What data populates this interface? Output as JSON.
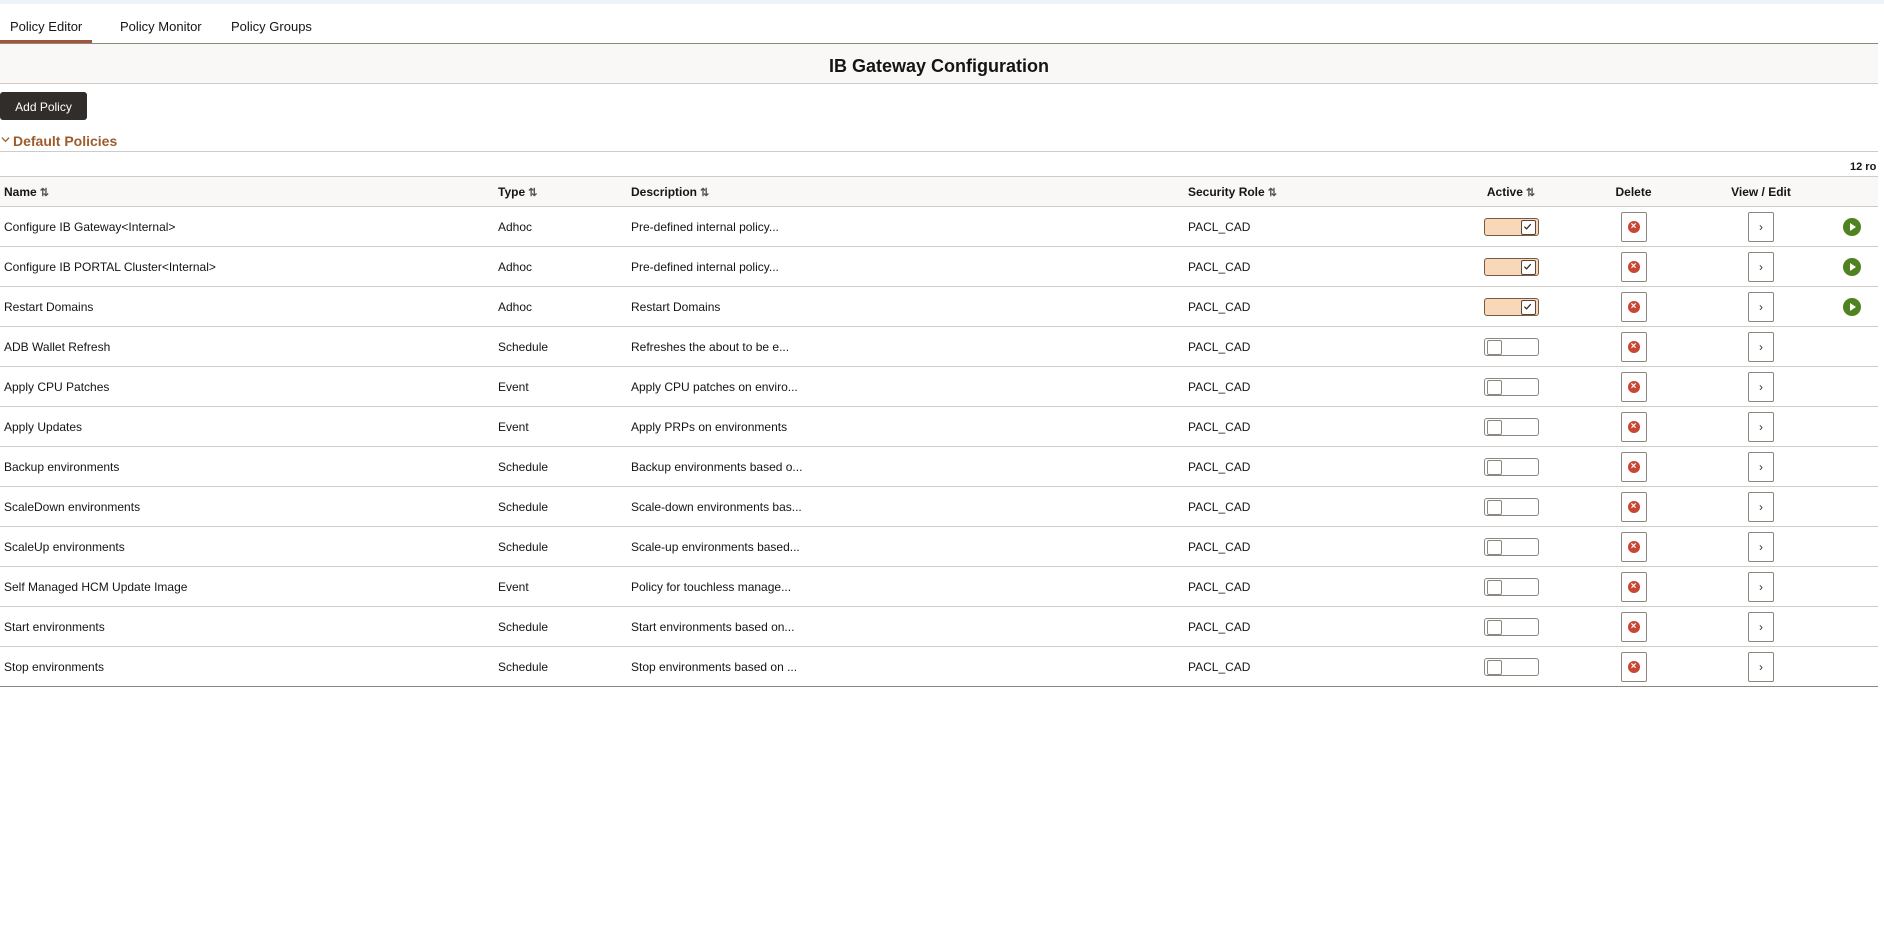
{
  "tabs": [
    {
      "label": "Policy Editor",
      "active": true
    },
    {
      "label": "Policy Monitor",
      "active": false
    },
    {
      "label": "Policy Groups",
      "active": false
    }
  ],
  "page_title": "IB Gateway Configuration",
  "add_button": "Add Policy",
  "section_title": "Default Policies",
  "row_count": "12 ro",
  "columns": {
    "name": "Name",
    "type": "Type",
    "description": "Description",
    "security_role": "Security Role",
    "active": "Active",
    "delete": "Delete",
    "view_edit": "View / Edit",
    "sort_icon": "⇅"
  },
  "rows": [
    {
      "name": "Configure IB Gateway<Internal>",
      "type": "Adhoc",
      "description": "Pre-defined internal policy...",
      "role": "PACL_CAD",
      "active": true,
      "run": true
    },
    {
      "name": "Configure IB PORTAL Cluster<Internal>",
      "type": "Adhoc",
      "description": "Pre-defined internal policy...",
      "role": "PACL_CAD",
      "active": true,
      "run": true
    },
    {
      "name": "Restart Domains",
      "type": "Adhoc",
      "description": "Restart Domains",
      "role": "PACL_CAD",
      "active": true,
      "run": true
    },
    {
      "name": "ADB Wallet Refresh",
      "type": "Schedule",
      "description": "Refreshes the about to be e...",
      "role": "PACL_CAD",
      "active": false,
      "run": false
    },
    {
      "name": "Apply CPU Patches",
      "type": "Event",
      "description": "Apply CPU patches on enviro...",
      "role": "PACL_CAD",
      "active": false,
      "run": false
    },
    {
      "name": "Apply Updates",
      "type": "Event",
      "description": "Apply PRPs on environments",
      "role": "PACL_CAD",
      "active": false,
      "run": false
    },
    {
      "name": "Backup environments",
      "type": "Schedule",
      "description": "Backup environments based o...",
      "role": "PACL_CAD",
      "active": false,
      "run": false
    },
    {
      "name": "ScaleDown environments",
      "type": "Schedule",
      "description": "Scale-down environments bas...",
      "role": "PACL_CAD",
      "active": false,
      "run": false
    },
    {
      "name": "ScaleUp environments",
      "type": "Schedule",
      "description": "Scale-up environments based...",
      "role": "PACL_CAD",
      "active": false,
      "run": false
    },
    {
      "name": "Self Managed HCM Update Image",
      "type": "Event",
      "description": "Policy for touchless manage...",
      "role": "PACL_CAD",
      "active": false,
      "run": false
    },
    {
      "name": "Start environments",
      "type": "Schedule",
      "description": "Start environments based on...",
      "role": "PACL_CAD",
      "active": false,
      "run": false
    },
    {
      "name": "Stop environments",
      "type": "Schedule",
      "description": "Stop environments based on ...",
      "role": "PACL_CAD",
      "active": false,
      "run": false
    }
  ]
}
